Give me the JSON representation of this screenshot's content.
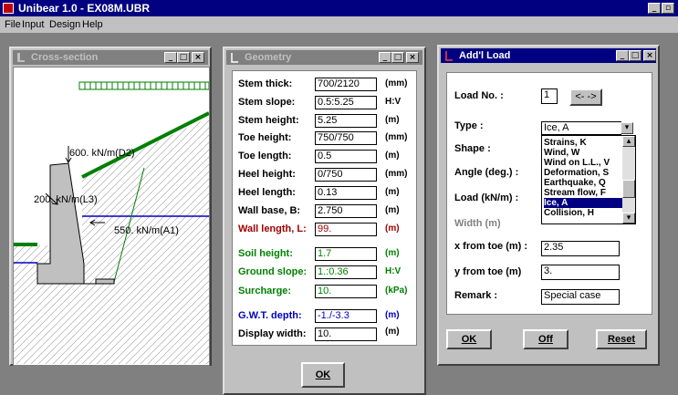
{
  "app": {
    "title": "Unibear 1.0 - EX08M.UBR",
    "menu": [
      "File",
      "Input",
      "Design",
      "Help"
    ]
  },
  "cross_section": {
    "title": "Cross-section",
    "labels": {
      "d2": "600. kN/m(D2)",
      "l3": "200. kN/m(L3)",
      "a1": "550. kN/m(A1)"
    }
  },
  "geometry": {
    "title": "Geometry",
    "rows": [
      {
        "label": "Stem thick:",
        "value": "700/2120",
        "unit": "(mm)",
        "color": "#000000"
      },
      {
        "label": "Stem slope:",
        "value": "0.5:5.25",
        "unit": "H:V",
        "color": "#000000"
      },
      {
        "label": "Stem height:",
        "value": "5.25",
        "unit": "(m)",
        "color": "#000000"
      },
      {
        "label": "Toe height:",
        "value": "750/750",
        "unit": "(mm)",
        "color": "#000000"
      },
      {
        "label": "Toe length:",
        "value": "0.5",
        "unit": "(m)",
        "color": "#000000"
      },
      {
        "label": "Heel height:",
        "value": "0/750",
        "unit": "(mm)",
        "color": "#000000"
      },
      {
        "label": "Heel length:",
        "value": "0.13",
        "unit": "(m)",
        "color": "#000000"
      },
      {
        "label": "Wall base, B:",
        "value": "2.750",
        "unit": "(m)",
        "color": "#000000"
      },
      {
        "label": "Wall length, L:",
        "value": "99.",
        "unit": "(m)",
        "color": "#a00000"
      },
      {
        "label": "Soil height:",
        "value": "1.7",
        "unit": "(m)",
        "color": "#008000"
      },
      {
        "label": "Ground slope:",
        "value": "1.:0.36",
        "unit": "H:V",
        "color": "#008000"
      },
      {
        "label": "Surcharge:",
        "value": "10.",
        "unit": "(kPa)",
        "color": "#008000"
      },
      {
        "label": "G.W.T. depth:",
        "value": "-1./-3.3",
        "unit": "(m)",
        "color": "#0000c0"
      },
      {
        "label": "Display width:",
        "value": "10.",
        "unit": "(m)",
        "color": "#000000"
      }
    ],
    "ok_label": "OK"
  },
  "addl_load": {
    "title": "Add'l Load",
    "load_no_label": "Load No. :",
    "load_no_value": "1",
    "prev_label": "<-",
    "next_label": "->",
    "type_label": "Type :",
    "type_value": "Ice, A",
    "shape_label": "Shape :",
    "angle_label": "Angle (deg.) :",
    "load_label": "Load (kN/m) :",
    "width_label": "Width (m)",
    "type_options": [
      "Strains, K",
      "Wind, W",
      "Wind on L.L., V",
      "Deformation, S",
      "Earthquake, Q",
      "Stream flow, F",
      "Ice, A",
      "Collision, H"
    ],
    "selected_option": "Ice, A",
    "x_label": "x from toe (m) :",
    "x_value": "2.35",
    "y_label": "y from toe (m)",
    "y_value": "3.",
    "remark_label": "Remark :",
    "remark_value": "Special case",
    "ok_label": "OK",
    "off_label": "Off",
    "reset_label": "Reset"
  },
  "colors": {
    "titlebar": "#000080",
    "face": "#c0c0c0",
    "ground": "#008000",
    "water": "#0000c0",
    "wall": "#c0c0c0"
  }
}
